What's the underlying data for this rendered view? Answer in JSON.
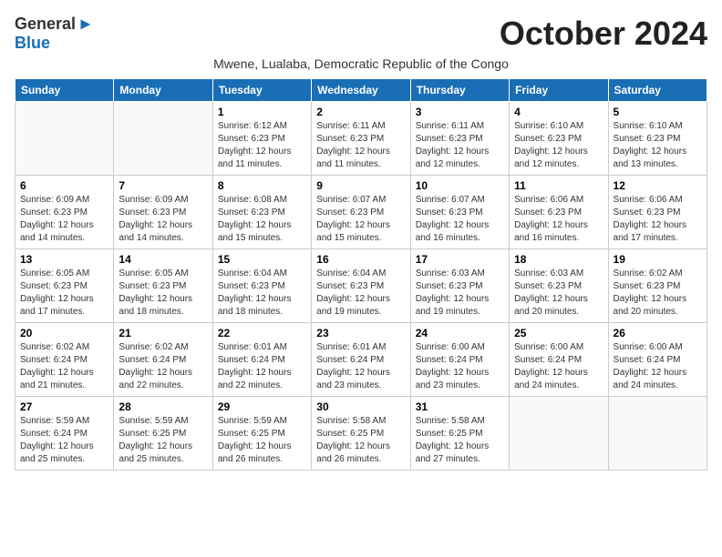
{
  "header": {
    "logo_line1": "General",
    "logo_line2": "Blue",
    "month_year": "October 2024",
    "subtitle": "Mwene, Lualaba, Democratic Republic of the Congo"
  },
  "days_of_week": [
    "Sunday",
    "Monday",
    "Tuesday",
    "Wednesday",
    "Thursday",
    "Friday",
    "Saturday"
  ],
  "weeks": [
    [
      {
        "day": "",
        "info": ""
      },
      {
        "day": "",
        "info": ""
      },
      {
        "day": "1",
        "info": "Sunrise: 6:12 AM\nSunset: 6:23 PM\nDaylight: 12 hours\nand 11 minutes."
      },
      {
        "day": "2",
        "info": "Sunrise: 6:11 AM\nSunset: 6:23 PM\nDaylight: 12 hours\nand 11 minutes."
      },
      {
        "day": "3",
        "info": "Sunrise: 6:11 AM\nSunset: 6:23 PM\nDaylight: 12 hours\nand 12 minutes."
      },
      {
        "day": "4",
        "info": "Sunrise: 6:10 AM\nSunset: 6:23 PM\nDaylight: 12 hours\nand 12 minutes."
      },
      {
        "day": "5",
        "info": "Sunrise: 6:10 AM\nSunset: 6:23 PM\nDaylight: 12 hours\nand 13 minutes."
      }
    ],
    [
      {
        "day": "6",
        "info": "Sunrise: 6:09 AM\nSunset: 6:23 PM\nDaylight: 12 hours\nand 14 minutes."
      },
      {
        "day": "7",
        "info": "Sunrise: 6:09 AM\nSunset: 6:23 PM\nDaylight: 12 hours\nand 14 minutes."
      },
      {
        "day": "8",
        "info": "Sunrise: 6:08 AM\nSunset: 6:23 PM\nDaylight: 12 hours\nand 15 minutes."
      },
      {
        "day": "9",
        "info": "Sunrise: 6:07 AM\nSunset: 6:23 PM\nDaylight: 12 hours\nand 15 minutes."
      },
      {
        "day": "10",
        "info": "Sunrise: 6:07 AM\nSunset: 6:23 PM\nDaylight: 12 hours\nand 16 minutes."
      },
      {
        "day": "11",
        "info": "Sunrise: 6:06 AM\nSunset: 6:23 PM\nDaylight: 12 hours\nand 16 minutes."
      },
      {
        "day": "12",
        "info": "Sunrise: 6:06 AM\nSunset: 6:23 PM\nDaylight: 12 hours\nand 17 minutes."
      }
    ],
    [
      {
        "day": "13",
        "info": "Sunrise: 6:05 AM\nSunset: 6:23 PM\nDaylight: 12 hours\nand 17 minutes."
      },
      {
        "day": "14",
        "info": "Sunrise: 6:05 AM\nSunset: 6:23 PM\nDaylight: 12 hours\nand 18 minutes."
      },
      {
        "day": "15",
        "info": "Sunrise: 6:04 AM\nSunset: 6:23 PM\nDaylight: 12 hours\nand 18 minutes."
      },
      {
        "day": "16",
        "info": "Sunrise: 6:04 AM\nSunset: 6:23 PM\nDaylight: 12 hours\nand 19 minutes."
      },
      {
        "day": "17",
        "info": "Sunrise: 6:03 AM\nSunset: 6:23 PM\nDaylight: 12 hours\nand 19 minutes."
      },
      {
        "day": "18",
        "info": "Sunrise: 6:03 AM\nSunset: 6:23 PM\nDaylight: 12 hours\nand 20 minutes."
      },
      {
        "day": "19",
        "info": "Sunrise: 6:02 AM\nSunset: 6:23 PM\nDaylight: 12 hours\nand 20 minutes."
      }
    ],
    [
      {
        "day": "20",
        "info": "Sunrise: 6:02 AM\nSunset: 6:24 PM\nDaylight: 12 hours\nand 21 minutes."
      },
      {
        "day": "21",
        "info": "Sunrise: 6:02 AM\nSunset: 6:24 PM\nDaylight: 12 hours\nand 22 minutes."
      },
      {
        "day": "22",
        "info": "Sunrise: 6:01 AM\nSunset: 6:24 PM\nDaylight: 12 hours\nand 22 minutes."
      },
      {
        "day": "23",
        "info": "Sunrise: 6:01 AM\nSunset: 6:24 PM\nDaylight: 12 hours\nand 23 minutes."
      },
      {
        "day": "24",
        "info": "Sunrise: 6:00 AM\nSunset: 6:24 PM\nDaylight: 12 hours\nand 23 minutes."
      },
      {
        "day": "25",
        "info": "Sunrise: 6:00 AM\nSunset: 6:24 PM\nDaylight: 12 hours\nand 24 minutes."
      },
      {
        "day": "26",
        "info": "Sunrise: 6:00 AM\nSunset: 6:24 PM\nDaylight: 12 hours\nand 24 minutes."
      }
    ],
    [
      {
        "day": "27",
        "info": "Sunrise: 5:59 AM\nSunset: 6:24 PM\nDaylight: 12 hours\nand 25 minutes."
      },
      {
        "day": "28",
        "info": "Sunrise: 5:59 AM\nSunset: 6:25 PM\nDaylight: 12 hours\nand 25 minutes."
      },
      {
        "day": "29",
        "info": "Sunrise: 5:59 AM\nSunset: 6:25 PM\nDaylight: 12 hours\nand 26 minutes."
      },
      {
        "day": "30",
        "info": "Sunrise: 5:58 AM\nSunset: 6:25 PM\nDaylight: 12 hours\nand 26 minutes."
      },
      {
        "day": "31",
        "info": "Sunrise: 5:58 AM\nSunset: 6:25 PM\nDaylight: 12 hours\nand 27 minutes."
      },
      {
        "day": "",
        "info": ""
      },
      {
        "day": "",
        "info": ""
      }
    ]
  ]
}
